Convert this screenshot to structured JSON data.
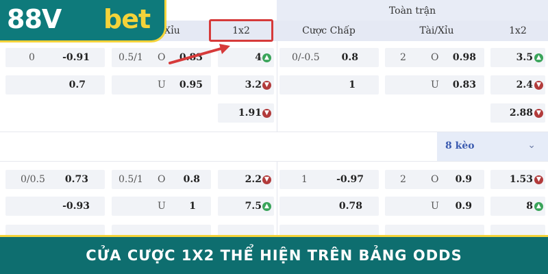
{
  "header": {
    "full_match": "Toàn trận",
    "cols": [
      "Xỉu",
      "1x2",
      "Cược Chấp",
      "Tài/Xỉu",
      "1x2"
    ]
  },
  "brand": {
    "logo_part1": "88V",
    "logo_part2": "bet"
  },
  "block1": {
    "r1": {
      "hcap_line": "0",
      "hcap_val": "-0.91",
      "ou_line": "0.5/1",
      "ou_side": "O",
      "ou_val": "0.83",
      "x12": "4",
      "ft_hcap_line": "0/-0.5",
      "ft_hcap_val": "0.8",
      "ft_ou_line": "2",
      "ft_ou_side": "O",
      "ft_ou_val": "0.98",
      "ft_x12": "3.5"
    },
    "r2": {
      "hcap_val": "0.7",
      "ou_side": "U",
      "ou_val": "0.95",
      "x12": "3.2",
      "ft_hcap_val": "1",
      "ft_ou_side": "U",
      "ft_ou_val": "0.83",
      "ft_x12": "2.4"
    },
    "r3": {
      "x12": "1.91",
      "ft_x12": "2.88"
    }
  },
  "more_bets": "8 kèo",
  "block2": {
    "r1": {
      "hcap_line": "0/0.5",
      "hcap_val": "0.73",
      "ou_line": "0.5/1",
      "ou_side": "O",
      "ou_val": "0.8",
      "x12": "2.2",
      "ft_hcap_line": "1",
      "ft_hcap_val": "-0.97",
      "ft_ou_line": "2",
      "ft_ou_side": "O",
      "ft_ou_val": "0.9",
      "ft_x12": "1.53"
    },
    "r2": {
      "hcap_val": "-0.93",
      "ou_side": "U",
      "ou_val": "1",
      "x12": "7.5",
      "ft_hcap_val": "0.78",
      "ft_ou_side": "U",
      "ft_ou_val": "0.9",
      "ft_x12": "8"
    }
  },
  "banner": "CỬA CƯỢC 1X2 THỂ HIỆN TRÊN BẢNG ODDS",
  "colors": {
    "teal": "#0e7a7b",
    "yellow": "#f4d33a",
    "up": "#3aa45a",
    "down": "#b23b3b",
    "highlight": "#d63a3a"
  }
}
